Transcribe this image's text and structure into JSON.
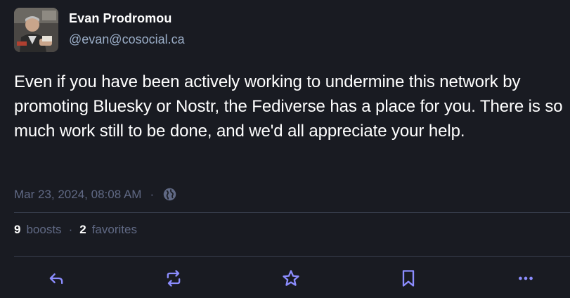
{
  "author": {
    "display_name": "Evan Prodromou",
    "handle": "@evan@cosocial.ca"
  },
  "post": {
    "content": "Even if you have been actively working to undermine this network by promoting Bluesky or Nostr, the Fediverse has a place for you. There is so much work still to be done, and we'd all appreciate your help.",
    "timestamp": "Mar 23, 2024, 08:08 AM",
    "separator": "·",
    "visibility_icon": "globe-icon"
  },
  "stats": {
    "boosts_count": "9",
    "boosts_label": "boosts",
    "separator": "·",
    "favorites_count": "2",
    "favorites_label": "favorites"
  },
  "actions": {
    "reply_icon": "reply-icon",
    "boost_icon": "boost-icon",
    "favorite_icon": "star-icon",
    "bookmark_icon": "bookmark-icon",
    "more_icon": "more-icon"
  },
  "colors": {
    "background": "#191b22",
    "text": "#ffffff",
    "muted": "#606984",
    "handle": "#9baec8",
    "divider": "#393f4f",
    "icon": "#8c8dff"
  }
}
